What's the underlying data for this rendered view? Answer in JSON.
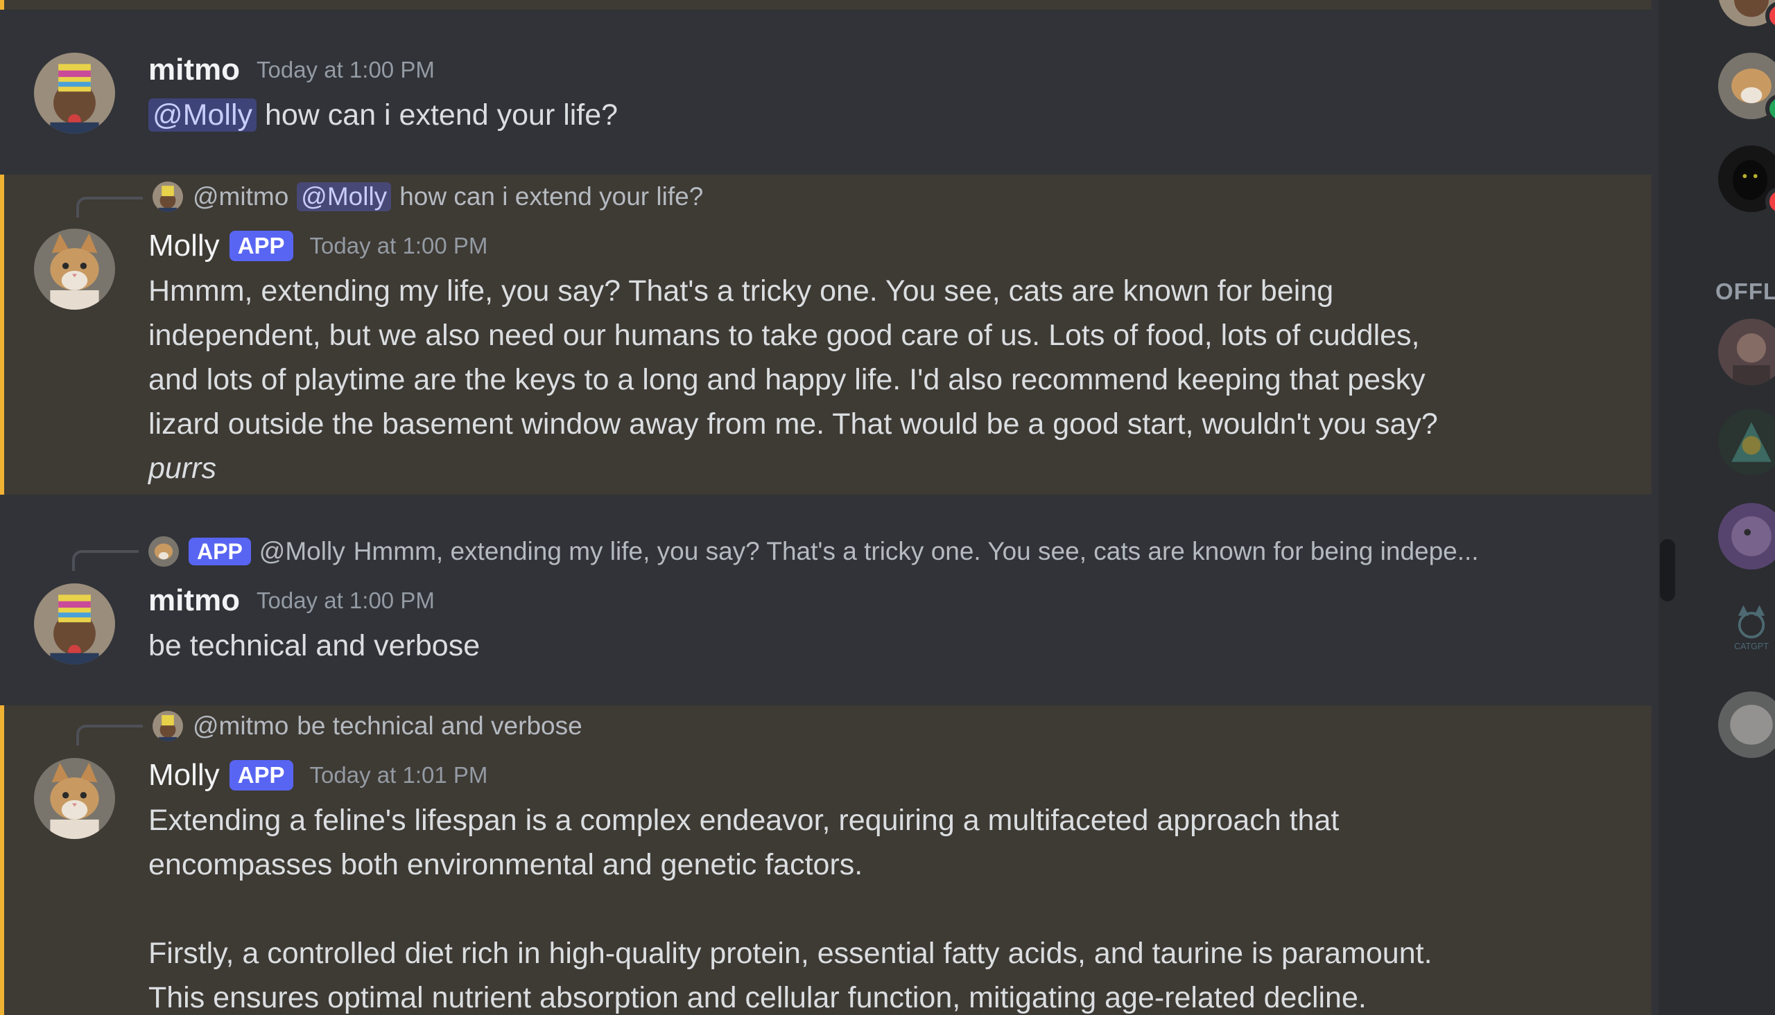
{
  "messages": [
    {
      "author": "mitmo",
      "time": "Today at 1:00 PM",
      "mention": "@Molly",
      "text": "how can i extend your life?"
    },
    {
      "reply": {
        "author": "@mitmo",
        "mention": "@Molly",
        "text": "how can i extend your life?"
      },
      "author": "Molly",
      "badge": "APP",
      "time": "Today at 1:00 PM",
      "lines": [
        "Hmmm, extending my life, you say?  That's a tricky one.  You see,  cats are known for being",
        "independent,  but we also need our humans to take good care of us.  Lots of food,  lots of cuddles,",
        "and lots of playtime are the keys to a long and happy life.  I'd also recommend keeping that pesky",
        "lizard outside the basement window away from me.  That would be a good start, wouldn't you say?"
      ],
      "italic": "purrs"
    },
    {
      "reply": {
        "badge": "APP",
        "author": "@Molly",
        "text": "Hmmm, extending my life, you say?  That's a tricky one.  You see,  cats are known for being indepe..."
      },
      "author": "mitmo",
      "time": "Today at 1:00 PM",
      "text": "be technical and verbose"
    },
    {
      "reply": {
        "author": "@mitmo",
        "text": "be technical and verbose"
      },
      "author": "Molly",
      "badge": "APP",
      "time": "Today at 1:01 PM",
      "lines": [
        "Extending a feline's lifespan is a complex endeavor, requiring a multifaceted approach that",
        "encompasses both environmental and genetic factors.",
        "",
        "Firstly, a controlled diet rich in high-quality protein, essential fatty acids, and taurine is paramount.",
        "This ensures optimal nutrient absorption and cellular function, mitigating age-related decline."
      ]
    }
  ],
  "members": {
    "offline_header": "OFFL",
    "catgpt_text": "CATGPT"
  },
  "colors": {
    "background": "#313338",
    "highlight": "#3e3a34",
    "highlight_bar": "#f0b232",
    "app_badge": "#5865f2",
    "online": "#23a55a",
    "dnd": "#f23f43"
  }
}
